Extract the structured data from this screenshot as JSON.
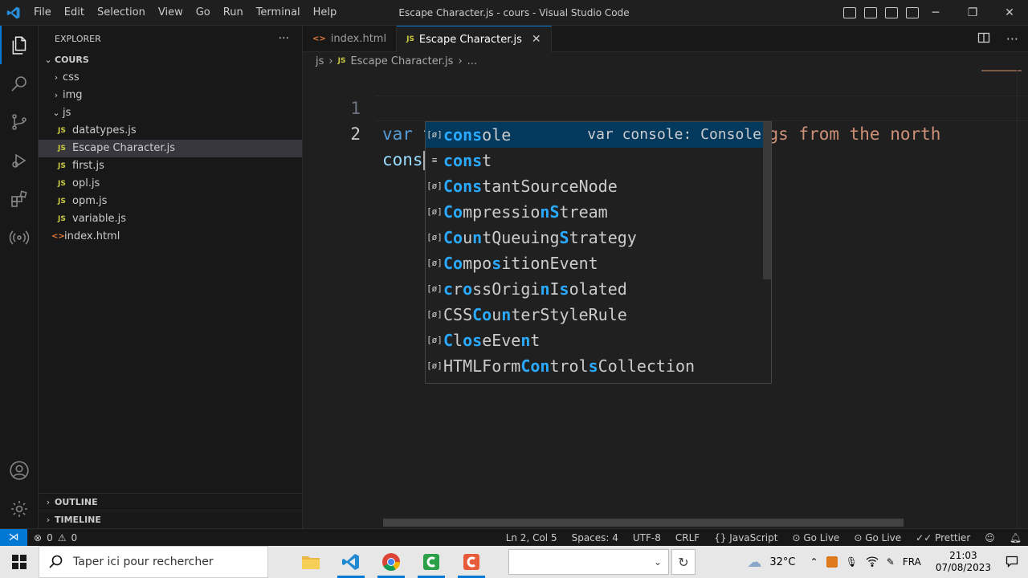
{
  "titlebar": {
    "menu": [
      "File",
      "Edit",
      "Selection",
      "View",
      "Go",
      "Run",
      "Terminal",
      "Help"
    ],
    "window_title": "Escape Character.js - cours - Visual Studio Code",
    "controls": {
      "minimize": "─",
      "maximize": "❐",
      "close": "✕"
    }
  },
  "sidebar": {
    "header": "EXPLORER",
    "more": "···",
    "root": "COURS",
    "tree": [
      {
        "label": "css",
        "kind": "folder",
        "expanded": false
      },
      {
        "label": "img",
        "kind": "folder",
        "expanded": false
      },
      {
        "label": "js",
        "kind": "folder",
        "expanded": true
      },
      {
        "label": "datatypes.js",
        "kind": "js"
      },
      {
        "label": "Escape Character.js",
        "kind": "js",
        "selected": true
      },
      {
        "label": "first.js",
        "kind": "js"
      },
      {
        "label": "opl.js",
        "kind": "js"
      },
      {
        "label": "opm.js",
        "kind": "js"
      },
      {
        "label": "variable.js",
        "kind": "js"
      },
      {
        "label": "index.html",
        "kind": "html"
      }
    ],
    "outline": "OUTLINE",
    "timeline": "TIMELINE",
    "js_badge": "JS",
    "html_badge": "<>"
  },
  "editor": {
    "tabs": [
      {
        "label": "index.html",
        "icon": "html"
      },
      {
        "label": "Escape Character.js",
        "icon": "js",
        "active": true
      }
    ],
    "tab_close": "✕",
    "breadcrumb": {
      "folder": "js",
      "file": "Escape Character.js",
      "more": "..."
    },
    "lines": [
      {
        "num": "1",
        "kw": "var",
        "name": "text",
        "op": "=",
        "str": "\"We are the so-called Vikings from the north"
      },
      {
        "num": "2",
        "typed": "cons"
      }
    ],
    "suggestions": [
      {
        "icon": "[ø]",
        "pre": "",
        "match": "cons",
        "rest": "ole",
        "detail": "var console: Console",
        "focused": true
      },
      {
        "icon": "≡",
        "pre": "",
        "match": "cons",
        "rest": "t"
      },
      {
        "html": "<b>Cons</b>tantSourceNode"
      },
      {
        "html": "<b>Co</b>mpressio<b>nS</b>tream"
      },
      {
        "html": "<b>Co</b>u<b>n</b>tQueuing<b>S</b>trategy"
      },
      {
        "html": "<b>Co</b>mpo<b>s</b>itionEvent"
      },
      {
        "html": "<b>c</b>r<b>o</b>ssOrigi<b>n</b>I<b>s</b>olated"
      },
      {
        "html": "CSS<b>Co</b>u<b>n</b>terStyleRule"
      },
      {
        "html": "<b>C</b>l<b>os</b>eEve<b>n</b>t"
      },
      {
        "html": "HTMLForm<b>Con</b>trol<b>s</b>Collection"
      }
    ]
  },
  "statusbar": {
    "errors": "0",
    "warnings": "0",
    "position": "Ln 2, Col 5",
    "spaces": "Spaces: 4",
    "encoding": "UTF-8",
    "eol": "CRLF",
    "language": "JavaScript",
    "golive1": "Go Live",
    "golive2": "Go Live",
    "prettier": "Prettier"
  },
  "taskbar": {
    "search_placeholder": "Taper ici pour rechercher",
    "temperature": "32°C",
    "language": "FRA",
    "time": "21:03",
    "date": "07/08/2023"
  },
  "colors": {
    "accent": "#0078d4",
    "keyword": "#569cd6",
    "variable": "#9cdcfe",
    "string": "#ce9178",
    "match": "#2aaaff",
    "js_badge": "#cbcb41",
    "html_badge": "#e37933"
  }
}
